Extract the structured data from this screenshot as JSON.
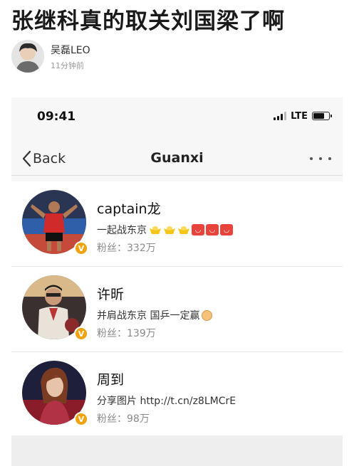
{
  "post": {
    "title": "张继科真的取关刘国梁了啊",
    "author": "吴磊LEO",
    "time": "11分钟前"
  },
  "screenshot": {
    "status_bar": {
      "time": "09:41",
      "network": "LTE"
    },
    "navbar": {
      "back_label": "Back",
      "title": "Guanxi"
    },
    "users": [
      {
        "name": "captain龙",
        "bio": "一起战东京",
        "fans": "粉丝：332万"
      },
      {
        "name": "许昕",
        "bio": "并肩战东京 国乒一定赢",
        "fans": "粉丝：139万"
      },
      {
        "name": "周到",
        "bio": "分享图片 http://t.cn/z8LMCrE",
        "fans": "粉丝：98万"
      }
    ]
  },
  "colors": {
    "verify_badge": "#f2a20b",
    "nav_divider": "#dcdcdc",
    "screenshot_bg": "#f7f7f7"
  },
  "icons": [
    "back-chevron-icon",
    "more-icon",
    "signal-icon",
    "battery-icon",
    "verified-icon"
  ]
}
